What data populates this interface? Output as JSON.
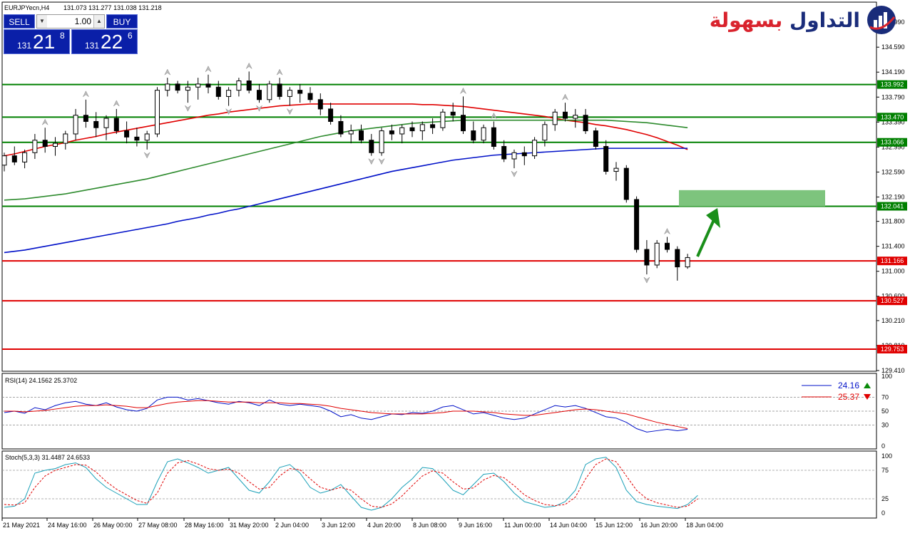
{
  "header": {
    "symbol_info": "EURJPYecn,H4",
    "ohlc": "131.073 131.277 131.038 131.218"
  },
  "trade_panel": {
    "sell_label": "SELL",
    "buy_label": "BUY",
    "lot_value": "1.00",
    "sell_prefix": "131",
    "sell_big": "21",
    "sell_sup": "8",
    "buy_prefix": "131",
    "buy_big": "22",
    "buy_sup": "6"
  },
  "logo": {
    "text_red": "بسهولة",
    "text_blue": "التداول"
  },
  "colors": {
    "support_line": "#e00000",
    "resistance_line": "#008000",
    "ma_red": "#e00000",
    "ma_green": "#2e8b2e",
    "ma_blue": "#0010c8",
    "target_zone": "#7dc47d",
    "arrow": "#1a8f1a"
  },
  "chart_data": [
    {
      "type": "candlestick",
      "name": "main",
      "ylim": [
        129.41,
        135.3
      ],
      "price_ticks": [
        "134.990",
        "134.590",
        "134.190",
        "133.790",
        "133.390",
        "132.990",
        "132.590",
        "132.190",
        "131.800",
        "131.400",
        "131.000",
        "130.600",
        "130.210",
        "129.810",
        "129.410"
      ],
      "time_labels": [
        "21 May 2021",
        "24 May 16:00",
        "26 May 00:00",
        "27 May 08:00",
        "28 May 16:00",
        "31 May 20:00",
        "2 Jun 04:00",
        "3 Jun 12:00",
        "4 Jun 20:00",
        "8 Jun 08:00",
        "9 Jun 16:00",
        "11 Jun 00:00",
        "14 Jun 04:00",
        "15 Jun 12:00",
        "16 Jun 20:00",
        "18 Jun 04:00"
      ],
      "horizontal_levels": [
        {
          "value": 133.992,
          "label": "133.992",
          "kind": "resistance"
        },
        {
          "value": 133.47,
          "label": "133.470",
          "kind": "resistance"
        },
        {
          "value": 133.066,
          "label": "133.066",
          "kind": "resistance"
        },
        {
          "value": 132.041,
          "label": "132.041",
          "kind": "resistance"
        },
        {
          "value": 131.166,
          "label": "131.166",
          "kind": "support"
        },
        {
          "value": 130.527,
          "label": "130.527",
          "kind": "support"
        },
        {
          "value": 129.753,
          "label": "129.753",
          "kind": "support"
        }
      ],
      "target_zone": {
        "low": 132.041,
        "high": 132.3
      },
      "ohlc": [
        [
          132.7,
          132.9,
          132.6,
          132.85
        ],
        [
          132.85,
          133.0,
          132.7,
          132.75
        ],
        [
          132.75,
          132.95,
          132.65,
          132.9
        ],
        [
          132.9,
          133.2,
          132.8,
          133.1
        ],
        [
          133.1,
          133.3,
          132.9,
          133.0
        ],
        [
          133.0,
          133.15,
          132.85,
          133.05
        ],
        [
          133.05,
          133.25,
          132.95,
          133.2
        ],
        [
          133.2,
          133.6,
          133.1,
          133.5
        ],
        [
          133.5,
          133.75,
          133.3,
          133.4
        ],
        [
          133.4,
          133.55,
          133.15,
          133.3
        ],
        [
          133.3,
          133.5,
          133.1,
          133.45
        ],
        [
          133.45,
          133.6,
          133.2,
          133.25
        ],
        [
          133.25,
          133.4,
          133.05,
          133.15
        ],
        [
          133.15,
          133.3,
          133.0,
          133.1
        ],
        [
          133.1,
          133.25,
          132.95,
          133.2
        ],
        [
          133.2,
          133.95,
          133.15,
          133.9
        ],
        [
          133.9,
          134.1,
          133.8,
          134.0
        ],
        [
          134.0,
          134.05,
          133.85,
          133.9
        ],
        [
          133.9,
          134.05,
          133.7,
          133.95
        ],
        [
          133.95,
          134.1,
          133.75,
          134.0
        ],
        [
          134.0,
          134.15,
          133.85,
          133.95
        ],
        [
          133.95,
          134.05,
          133.75,
          133.8
        ],
        [
          133.8,
          133.95,
          133.65,
          133.9
        ],
        [
          133.9,
          134.1,
          133.8,
          134.05
        ],
        [
          134.05,
          134.2,
          133.85,
          133.9
        ],
        [
          133.9,
          134.0,
          133.7,
          133.75
        ],
        [
          133.75,
          134.05,
          133.7,
          134.0
        ],
        [
          134.0,
          134.1,
          133.75,
          133.8
        ],
        [
          133.8,
          133.95,
          133.65,
          133.9
        ],
        [
          133.9,
          134.0,
          133.7,
          133.85
        ],
        [
          133.85,
          133.95,
          133.7,
          133.75
        ],
        [
          133.75,
          133.85,
          133.5,
          133.6
        ],
        [
          133.6,
          133.7,
          133.35,
          133.4
        ],
        [
          133.4,
          133.5,
          133.15,
          133.2
        ],
        [
          133.2,
          133.35,
          133.05,
          133.25
        ],
        [
          133.25,
          133.35,
          133.05,
          133.1
        ],
        [
          133.1,
          133.2,
          132.85,
          132.9
        ],
        [
          132.9,
          133.3,
          132.85,
          133.25
        ],
        [
          133.25,
          133.35,
          133.1,
          133.2
        ],
        [
          133.2,
          133.35,
          133.05,
          133.3
        ],
        [
          133.3,
          133.4,
          133.15,
          133.25
        ],
        [
          133.25,
          133.4,
          133.1,
          133.35
        ],
        [
          133.35,
          133.45,
          133.2,
          133.3
        ],
        [
          133.3,
          133.6,
          133.25,
          133.55
        ],
        [
          133.55,
          133.7,
          133.4,
          133.5
        ],
        [
          133.5,
          133.8,
          133.2,
          133.25
        ],
        [
          133.25,
          133.4,
          133.05,
          133.1
        ],
        [
          133.1,
          133.35,
          133.05,
          133.3
        ],
        [
          133.3,
          133.4,
          132.95,
          133.0
        ],
        [
          133.0,
          133.1,
          132.75,
          132.8
        ],
        [
          132.8,
          132.95,
          132.65,
          132.9
        ],
        [
          132.9,
          133.0,
          132.7,
          132.85
        ],
        [
          132.85,
          133.15,
          132.8,
          133.1
        ],
        [
          133.1,
          133.4,
          133.0,
          133.35
        ],
        [
          133.35,
          133.6,
          133.25,
          133.55
        ],
        [
          133.55,
          133.7,
          133.4,
          133.45
        ],
        [
          133.45,
          133.6,
          133.3,
          133.5
        ],
        [
          133.5,
          133.6,
          133.2,
          133.25
        ],
        [
          133.25,
          133.3,
          132.95,
          133.0
        ],
        [
          133.0,
          133.1,
          132.55,
          132.6
        ],
        [
          132.6,
          132.75,
          132.45,
          132.65
        ],
        [
          132.65,
          132.7,
          132.1,
          132.15
        ],
        [
          132.15,
          132.2,
          131.3,
          131.35
        ],
        [
          131.35,
          131.5,
          130.95,
          131.1
        ],
        [
          131.1,
          131.5,
          131.05,
          131.45
        ],
        [
          131.45,
          131.55,
          131.3,
          131.35
        ],
        [
          131.35,
          131.4,
          130.85,
          131.07
        ],
        [
          131.07,
          131.28,
          131.04,
          131.22
        ]
      ],
      "ma": [
        {
          "color": "red",
          "values": [
            132.85,
            132.88,
            132.92,
            132.96,
            133.0,
            133.03,
            133.06,
            133.1,
            133.13,
            133.16,
            133.2,
            133.23,
            133.26,
            133.29,
            133.32,
            133.35,
            133.38,
            133.41,
            133.44,
            133.47,
            133.5,
            133.52,
            133.55,
            133.57,
            133.59,
            133.61,
            133.63,
            133.65,
            133.66,
            133.67,
            133.68,
            133.68,
            133.68,
            133.68,
            133.68,
            133.68,
            133.68,
            133.68,
            133.68,
            133.68,
            133.68,
            133.67,
            133.67,
            133.66,
            133.65,
            133.64,
            133.62,
            133.6,
            133.58,
            133.56,
            133.54,
            133.52,
            133.5,
            133.48,
            133.45,
            133.42,
            133.4,
            133.38,
            133.35,
            133.33,
            133.3,
            133.27,
            133.23,
            133.19,
            133.14,
            133.08,
            133.02,
            132.95
          ]
        },
        {
          "color": "green",
          "values": [
            132.14,
            132.15,
            132.16,
            132.18,
            132.2,
            132.22,
            132.24,
            132.27,
            132.3,
            132.33,
            132.36,
            132.39,
            132.42,
            132.45,
            132.48,
            132.52,
            132.56,
            132.6,
            132.64,
            132.68,
            132.72,
            132.76,
            132.8,
            132.84,
            132.88,
            132.92,
            132.96,
            133.0,
            133.04,
            133.08,
            133.12,
            133.16,
            133.19,
            133.22,
            133.25,
            133.27,
            133.29,
            133.31,
            133.33,
            133.35,
            133.37,
            133.38,
            133.39,
            133.4,
            133.41,
            133.42,
            133.42,
            133.42,
            133.42,
            133.42,
            133.42,
            133.42,
            133.42,
            133.42,
            133.42,
            133.42,
            133.42,
            133.42,
            133.42,
            133.42,
            133.41,
            133.4,
            133.39,
            133.38,
            133.36,
            133.34,
            133.32,
            133.3
          ]
        },
        {
          "color": "blue",
          "values": [
            131.3,
            131.32,
            131.34,
            131.37,
            131.4,
            131.43,
            131.46,
            131.49,
            131.52,
            131.55,
            131.58,
            131.61,
            131.64,
            131.67,
            131.7,
            131.73,
            131.76,
            131.8,
            131.83,
            131.86,
            131.9,
            131.93,
            131.97,
            132.0,
            132.04,
            132.08,
            132.12,
            132.16,
            132.2,
            132.24,
            132.28,
            132.32,
            132.36,
            132.4,
            132.44,
            132.48,
            132.52,
            132.56,
            132.6,
            132.63,
            132.66,
            132.69,
            132.72,
            132.75,
            132.78,
            132.8,
            132.82,
            132.84,
            132.86,
            132.87,
            132.88,
            132.89,
            132.9,
            132.91,
            132.92,
            132.93,
            132.94,
            132.95,
            132.96,
            132.97,
            132.97,
            132.97,
            132.97,
            132.97,
            132.97,
            132.97,
            132.97,
            132.97
          ]
        }
      ]
    },
    {
      "type": "line",
      "name": "rsi",
      "title": "RSI(14) 24.1562 25.3702",
      "ylim": [
        0,
        100
      ],
      "ticks": [
        "100",
        "70",
        "50",
        "30",
        "0"
      ],
      "levels": [
        70,
        50,
        30
      ],
      "legend": [
        {
          "label": "24.16",
          "direction": "up",
          "color": "#0010c8"
        },
        {
          "label": "25.37",
          "direction": "down",
          "color": "#e00000"
        }
      ],
      "series": [
        {
          "color": "blue",
          "values": [
            48,
            50,
            47,
            55,
            52,
            58,
            62,
            64,
            60,
            58,
            62,
            56,
            52,
            50,
            54,
            66,
            70,
            70,
            66,
            68,
            65,
            62,
            60,
            64,
            62,
            58,
            66,
            60,
            58,
            60,
            58,
            56,
            50,
            42,
            45,
            40,
            38,
            42,
            46,
            45,
            48,
            47,
            50,
            56,
            58,
            52,
            46,
            48,
            44,
            40,
            38,
            40,
            46,
            52,
            58,
            56,
            58,
            54,
            48,
            42,
            40,
            34,
            25,
            20,
            22,
            24,
            22,
            24
          ]
        },
        {
          "color": "red",
          "values": [
            50,
            50,
            49,
            50,
            51,
            53,
            55,
            57,
            58,
            58,
            59,
            58,
            57,
            55,
            55,
            58,
            61,
            63,
            64,
            65,
            65,
            64,
            63,
            63,
            63,
            62,
            62,
            62,
            61,
            61,
            60,
            59,
            57,
            54,
            52,
            50,
            48,
            47,
            46,
            46,
            46,
            46,
            47,
            48,
            50,
            50,
            50,
            49,
            48,
            46,
            45,
            44,
            44,
            46,
            48,
            50,
            52,
            53,
            52,
            50,
            48,
            46,
            42,
            38,
            34,
            31,
            28,
            25
          ]
        }
      ]
    },
    {
      "type": "line",
      "name": "stoch",
      "title": "Stoch(5,3,3) 31.4487 24.6533",
      "ylim": [
        0,
        100
      ],
      "ticks": [
        "100",
        "75",
        "25",
        "0"
      ],
      "levels": [
        75,
        25
      ],
      "series": [
        {
          "color": "teal",
          "values": [
            10,
            12,
            25,
            70,
            75,
            78,
            85,
            88,
            80,
            60,
            45,
            35,
            25,
            15,
            15,
            55,
            90,
            95,
            88,
            80,
            70,
            75,
            80,
            60,
            40,
            35,
            55,
            80,
            85,
            70,
            45,
            35,
            40,
            50,
            30,
            10,
            5,
            10,
            25,
            45,
            60,
            80,
            78,
            60,
            40,
            32,
            50,
            68,
            70,
            55,
            35,
            20,
            15,
            10,
            12,
            20,
            40,
            85,
            95,
            98,
            80,
            40,
            20,
            15,
            12,
            10,
            8,
            15,
            31
          ]
        },
        {
          "color": "red",
          "values": [
            15,
            14,
            18,
            45,
            65,
            75,
            80,
            85,
            84,
            72,
            55,
            42,
            32,
            22,
            17,
            35,
            70,
            88,
            92,
            86,
            78,
            75,
            77,
            70,
            55,
            42,
            45,
            65,
            78,
            76,
            60,
            45,
            40,
            45,
            40,
            25,
            12,
            10,
            16,
            30,
            48,
            65,
            74,
            70,
            55,
            42,
            44,
            58,
            66,
            62,
            48,
            32,
            22,
            15,
            13,
            15,
            28,
            60,
            85,
            95,
            90,
            65,
            40,
            25,
            18,
            14,
            10,
            12,
            25
          ]
        }
      ]
    }
  ]
}
